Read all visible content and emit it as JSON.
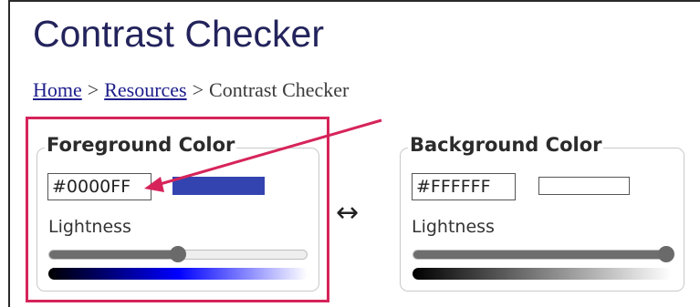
{
  "page": {
    "title": "Contrast Checker"
  },
  "breadcrumb": {
    "home": "Home",
    "separator": ">",
    "resources": "Resources",
    "current": "Contrast Checker"
  },
  "foreground": {
    "legend": "Foreground Color",
    "hex_value": "#0000FF",
    "swatch_color": "#3344b0",
    "lightness_label": "Lightness",
    "lightness_fraction": 0.5,
    "gradient_colors": [
      "#000000",
      "#0000ff",
      "#ffffff"
    ]
  },
  "background": {
    "legend": "Background Color",
    "hex_value": "#FFFFFF",
    "swatch_color": "#ffffff",
    "lightness_label": "Lightness",
    "lightness_fraction": 1.0,
    "gradient_colors": [
      "#000000",
      "#ffffff"
    ]
  },
  "swap": {
    "symbol": "↔"
  },
  "colors": {
    "highlight": "#d6245a",
    "title": "#23235c",
    "link": "#1e1e8c"
  },
  "icons": {
    "annotation": "pointer-arrow-icon",
    "swap": "swap-arrow-icon"
  }
}
